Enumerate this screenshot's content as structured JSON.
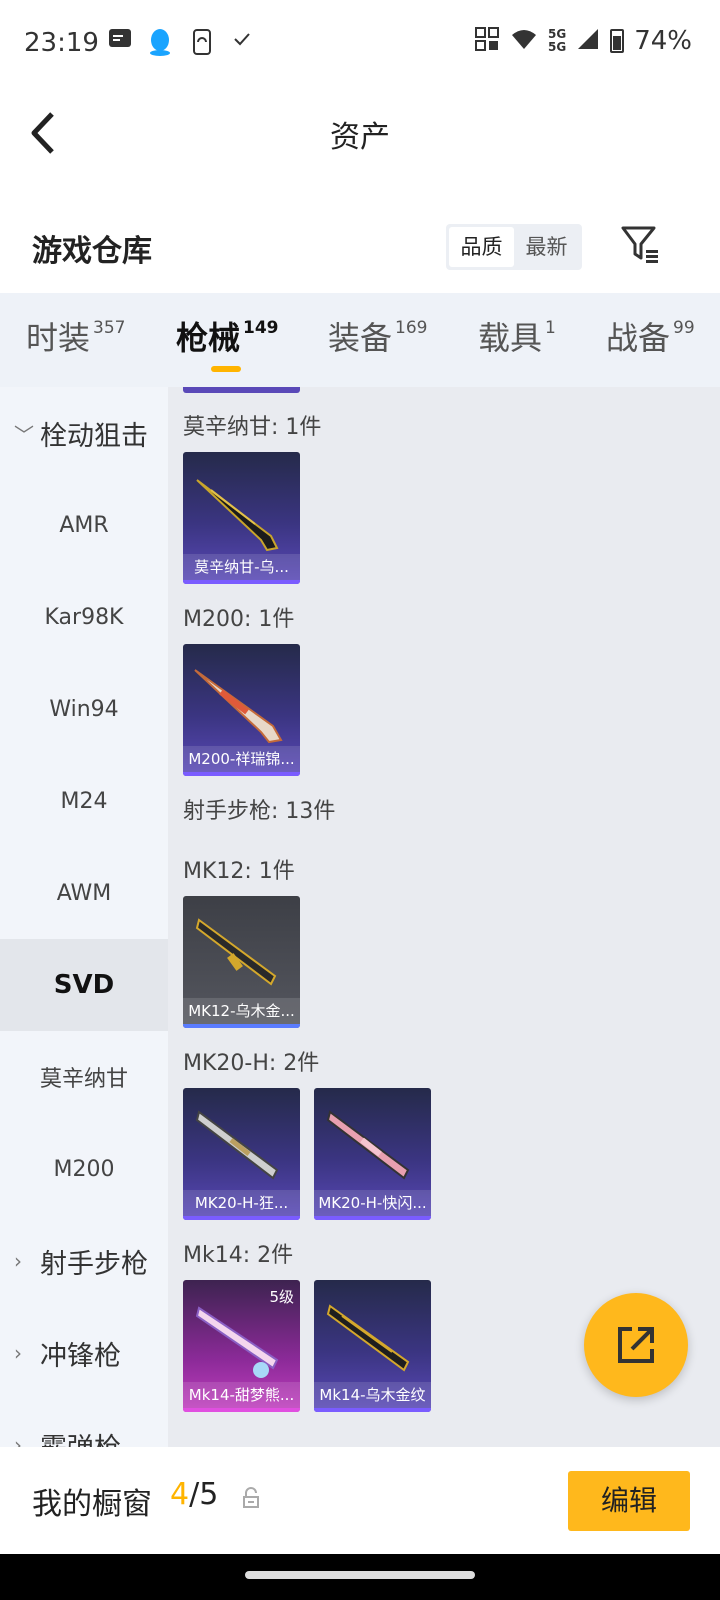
{
  "status_bar": {
    "time": "23:19",
    "network": "5G",
    "battery": "74%"
  },
  "header": {
    "title": "资产"
  },
  "warehouse": {
    "title": "游戏仓库",
    "sort_options": [
      "品质",
      "最新"
    ],
    "active_sort": "品质"
  },
  "tabs": [
    {
      "label": "时装",
      "count": "357"
    },
    {
      "label": "枪械",
      "count": "149"
    },
    {
      "label": "装备",
      "count": "169"
    },
    {
      "label": "载具",
      "count": "1"
    },
    {
      "label": "战备",
      "count": "99"
    }
  ],
  "sidebar": {
    "items": [
      {
        "label": "栓动狙击"
      },
      {
        "label": "AMR"
      },
      {
        "label": "Kar98K"
      },
      {
        "label": "Win94"
      },
      {
        "label": "M24"
      },
      {
        "label": "AWM"
      },
      {
        "label": "SVD"
      },
      {
        "label": "莫辛纳甘"
      },
      {
        "label": "M200"
      },
      {
        "label": "射手步枪"
      },
      {
        "label": "冲锋枪"
      },
      {
        "label": "霰弹枪"
      }
    ]
  },
  "content": {
    "groups": [
      {
        "label": "莫辛纳甘: 1件",
        "items": [
          {
            "name": "莫辛纳甘-乌..."
          }
        ]
      },
      {
        "label": "M200: 1件",
        "items": [
          {
            "name": "M200-祥瑞锦..."
          }
        ]
      },
      {
        "label": "射手步枪: 13件"
      },
      {
        "label": "MK12: 1件",
        "items": [
          {
            "name": "MK12-乌木金..."
          }
        ]
      },
      {
        "label": "MK20-H: 2件",
        "items": [
          {
            "name": "MK20-H-狂..."
          },
          {
            "name": "MK20-H-快闪..."
          }
        ]
      },
      {
        "label": "Mk14: 2件",
        "items": [
          {
            "name": "Mk14-甜梦熊...",
            "level": "5级"
          },
          {
            "name": "Mk14-乌木金纹"
          }
        ]
      }
    ]
  },
  "bottom": {
    "label": "我的橱窗",
    "current": "4",
    "total": "/5",
    "edit_label": "编辑"
  },
  "colors": {
    "accent": "#ffb81c",
    "card_purple": "#3b3582"
  }
}
